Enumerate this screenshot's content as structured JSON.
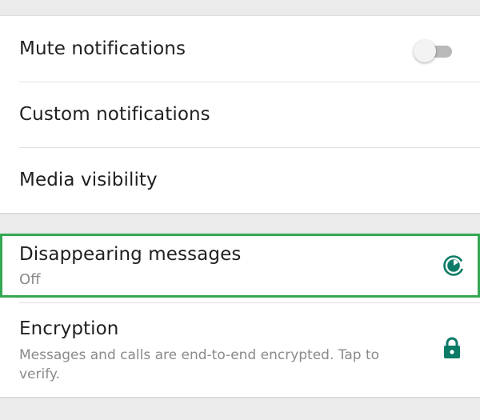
{
  "settings": {
    "mute_notifications": {
      "label": "Mute notifications",
      "toggle_on": false,
      "icon": "toggle-switch"
    },
    "custom_notifications": {
      "label": "Custom notifications"
    },
    "media_visibility": {
      "label": "Media visibility"
    },
    "disappearing_messages": {
      "label": "Disappearing messages",
      "value": "Off",
      "icon": "timer-icon",
      "highlight_color": "#34a853"
    },
    "encryption": {
      "label": "Encryption",
      "description": "Messages and calls are end-to-end encrypted. Tap to verify.",
      "icon": "lock-icon"
    }
  },
  "colors": {
    "accent": "#0b7a66",
    "background": "#ebebeb",
    "card": "#ffffff",
    "primary_text": "#1f1f1f",
    "secondary_text": "#8a8a8a"
  }
}
